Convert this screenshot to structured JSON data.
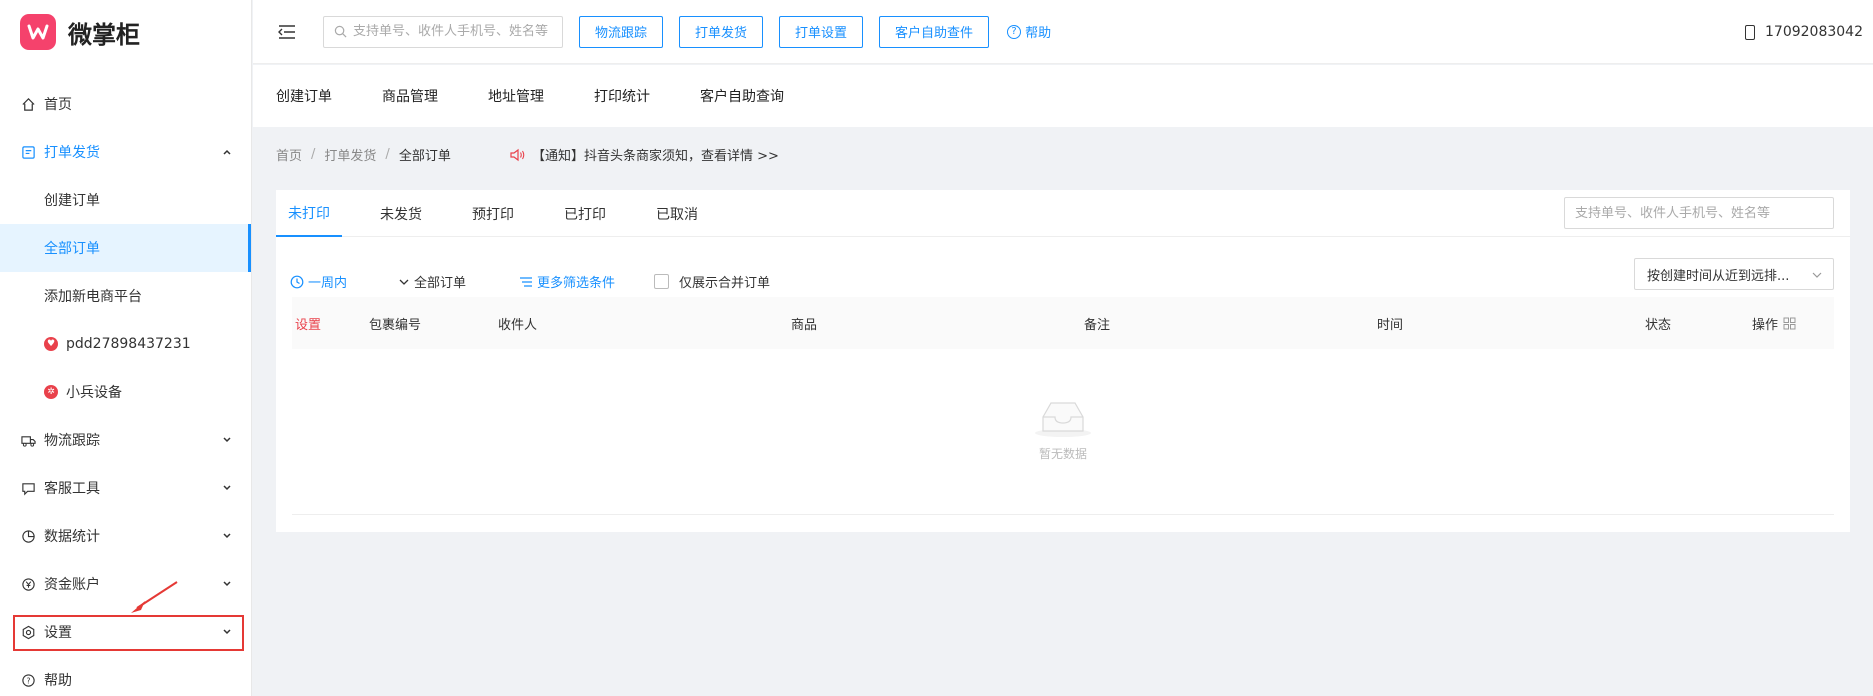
{
  "app": {
    "name": "微掌柜"
  },
  "sidebar": {
    "items": [
      {
        "label": "首页"
      },
      {
        "label": "打单发货"
      },
      {
        "label": "物流跟踪"
      },
      {
        "label": "客服工具"
      },
      {
        "label": "数据统计"
      },
      {
        "label": "资金账户"
      },
      {
        "label": "设置"
      },
      {
        "label": "帮助"
      }
    ],
    "sub_items": [
      {
        "label": "创建订单"
      },
      {
        "label": "全部订单"
      },
      {
        "label": "添加新电商平台"
      },
      {
        "label": "pdd27898437231"
      },
      {
        "label": "小兵设备"
      }
    ]
  },
  "header": {
    "search_placeholder": "支持单号、收件人手机号、姓名等",
    "buttons": [
      "物流跟踪",
      "打单发货",
      "打单设置",
      "客户自助查件"
    ],
    "help": "帮助",
    "user_phone": "17092083042"
  },
  "quicknav": [
    "创建订单",
    "商品管理",
    "地址管理",
    "打印统计",
    "客户自助查询"
  ],
  "breadcrumb": [
    "首页",
    "打单发货",
    "全部订单"
  ],
  "notice": "【通知】抖音头条商家须知，查看详情 >>",
  "tabs": [
    "未打印",
    "未发货",
    "预打印",
    "已打印",
    "已取消"
  ],
  "table_search_placeholder": "支持单号、收件人手机号、姓名等",
  "filters": {
    "time": "一周内",
    "orders": "全部订单",
    "more": "更多筛选条件",
    "merged_only": "仅展示合并订单"
  },
  "sort": "按创建时间从近到远排...",
  "table": {
    "columns": [
      "设置",
      "包裹编号",
      "收件人",
      "商品",
      "备注",
      "时间",
      "状态",
      "操作"
    ]
  },
  "empty_text": "暂无数据",
  "colors": {
    "brand": "#f5426c",
    "accent": "#1890ff",
    "highlight": "#e53935"
  }
}
